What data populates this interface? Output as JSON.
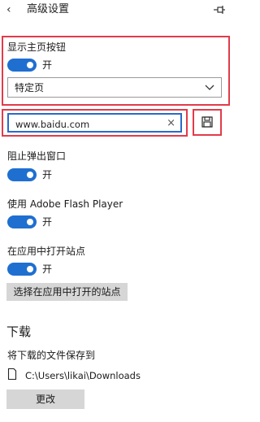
{
  "header": {
    "back_glyph": "‹",
    "title": "高级设置",
    "pin_icon": "pin-icon"
  },
  "home_button": {
    "label": "显示主页按钮",
    "toggle_state": "开",
    "select_value": "特定页",
    "url_value": "www.baidu.com",
    "clear_glyph": "×",
    "save_icon": "save-icon"
  },
  "popups": {
    "label": "阻止弹出窗口",
    "toggle_state": "开"
  },
  "flash": {
    "label": "使用 Adobe Flash Player",
    "toggle_state": "开"
  },
  "open_in_apps": {
    "label": "在应用中打开站点",
    "toggle_state": "开",
    "button_label": "选择在应用中打开的站点"
  },
  "downloads": {
    "heading": "下载",
    "label": "将下载的文件保存到",
    "path": "C:\\Users\\likai\\Downloads",
    "change_button": "更改"
  },
  "colors": {
    "accent": "#1f6fd0",
    "highlight": "#e23b4a",
    "button_gray": "#d6d6d6"
  }
}
